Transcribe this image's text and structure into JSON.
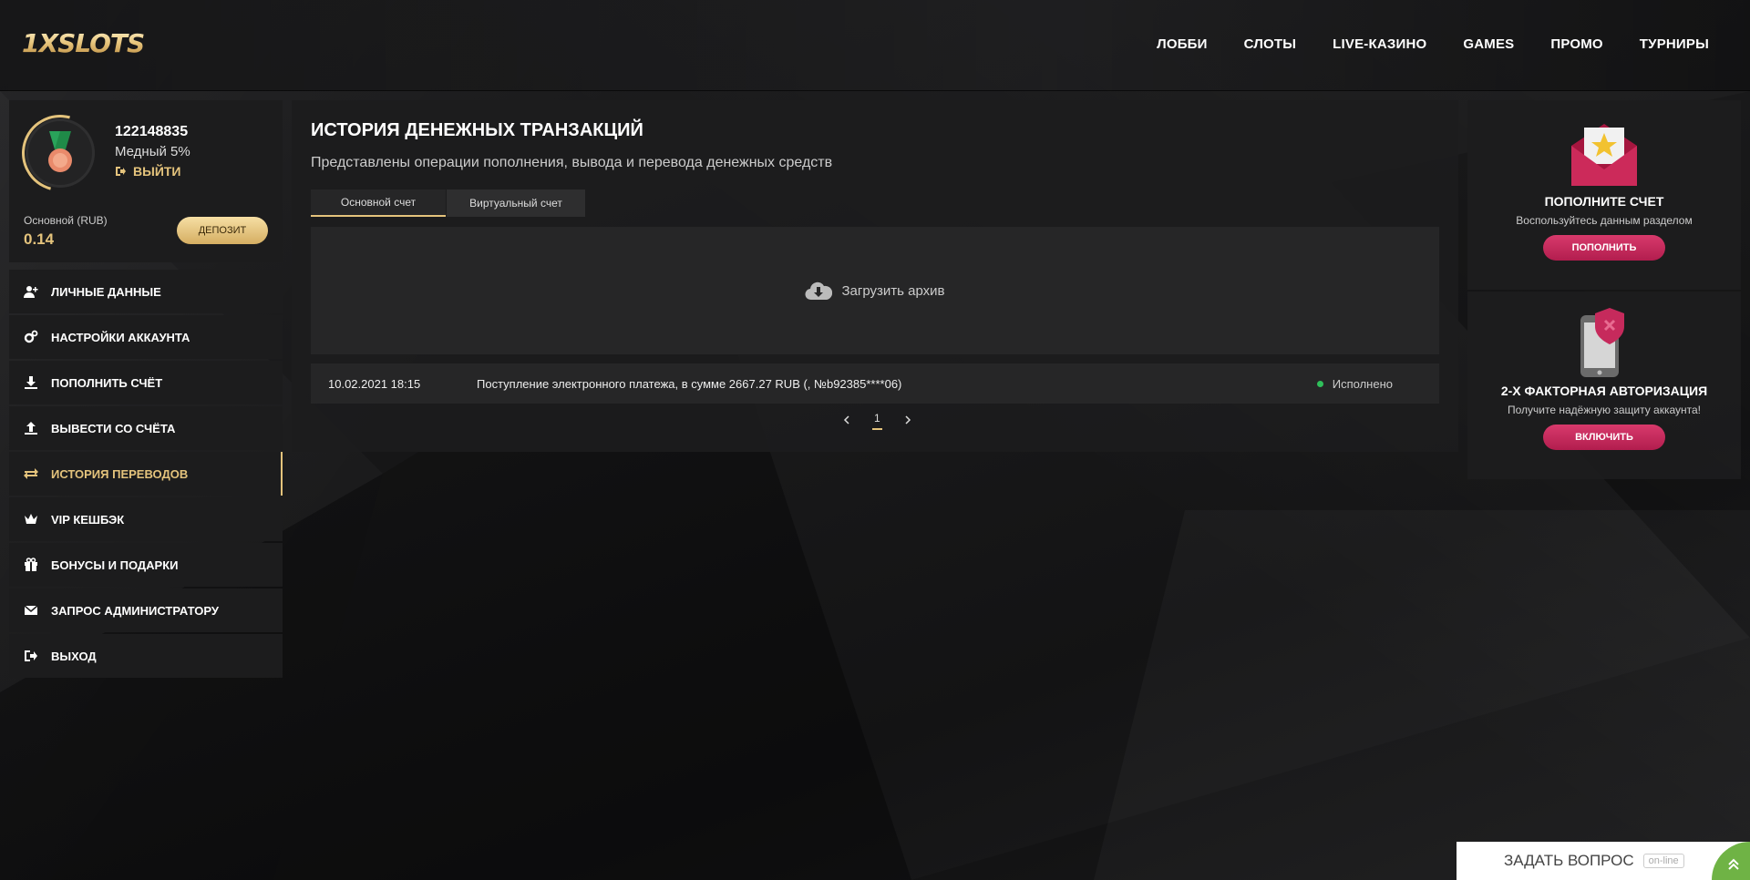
{
  "header": {
    "logo": "1XSLOTS",
    "nav": [
      "ЛОББИ",
      "СЛОТЫ",
      "LIVE-КАЗИНО",
      "GAMES",
      "ПРОМО",
      "ТУРНИРЫ"
    ]
  },
  "profile": {
    "user_id": "122148835",
    "level": "Медный 5%",
    "logout": "ВЫЙТИ",
    "balance_label": "Основной (RUB)",
    "balance_value": "0.14",
    "deposit_button": "ДЕПОЗИТ"
  },
  "menu": [
    {
      "label": "ЛИЧНЫЕ ДАННЫЕ",
      "icon": "user-plus-icon"
    },
    {
      "label": "НАСТРОЙКИ АККАУНТА",
      "icon": "gears-icon"
    },
    {
      "label": "ПОПОЛНИТЬ СЧЁТ",
      "icon": "download-icon"
    },
    {
      "label": "ВЫВЕСТИ СО СЧЁТА",
      "icon": "upload-icon"
    },
    {
      "label": "ИСТОРИЯ ПЕРЕВОДОВ",
      "icon": "transfer-arrows-icon",
      "active": true
    },
    {
      "label": "VIP КЕШБЭК",
      "icon": "crown-icon"
    },
    {
      "label": "БОНУСЫ И ПОДАРКИ",
      "icon": "gift-icon"
    },
    {
      "label": "ЗАПРОС АДМИНИСТРАТОРУ",
      "icon": "envelope-icon"
    },
    {
      "label": "ВЫХОД",
      "icon": "exit-icon"
    }
  ],
  "main": {
    "title": "ИСТОРИЯ ДЕНЕЖНЫХ ТРАНЗАКЦИЙ",
    "subtitle": "Представлены операции пополнения, вывода и перевода денежных средств",
    "tabs": [
      "Основной счет",
      "Виртуальный счет"
    ],
    "archive_label": "Загрузить архив",
    "transactions": [
      {
        "date": "10.02.2021 18:15",
        "description": "Поступление электронного платежа, в сумме 2667.27 RUB (, №b92385****06)",
        "status": "Исполнено"
      }
    ],
    "pager": {
      "current": "1"
    }
  },
  "widgets": {
    "deposit": {
      "title": "ПОПОЛНИТЕ СЧЕТ",
      "subtitle": "Воспользуйтесь данным разделом",
      "button": "ПОПОЛНИТЬ"
    },
    "twofa": {
      "title": "2-Х ФАКТОРНАЯ АВТОРИЗАЦИЯ",
      "subtitle": "Получите надёжную защиту аккаунта!",
      "button": "ВКЛЮЧИТЬ"
    }
  },
  "chat": {
    "label": "ЗАДАТЬ ВОПРОС",
    "status": "on-line"
  },
  "colors": {
    "accent_gold": "#e4c37c",
    "button_pink": "#c62a5c",
    "status_green": "#2fbf5a"
  }
}
